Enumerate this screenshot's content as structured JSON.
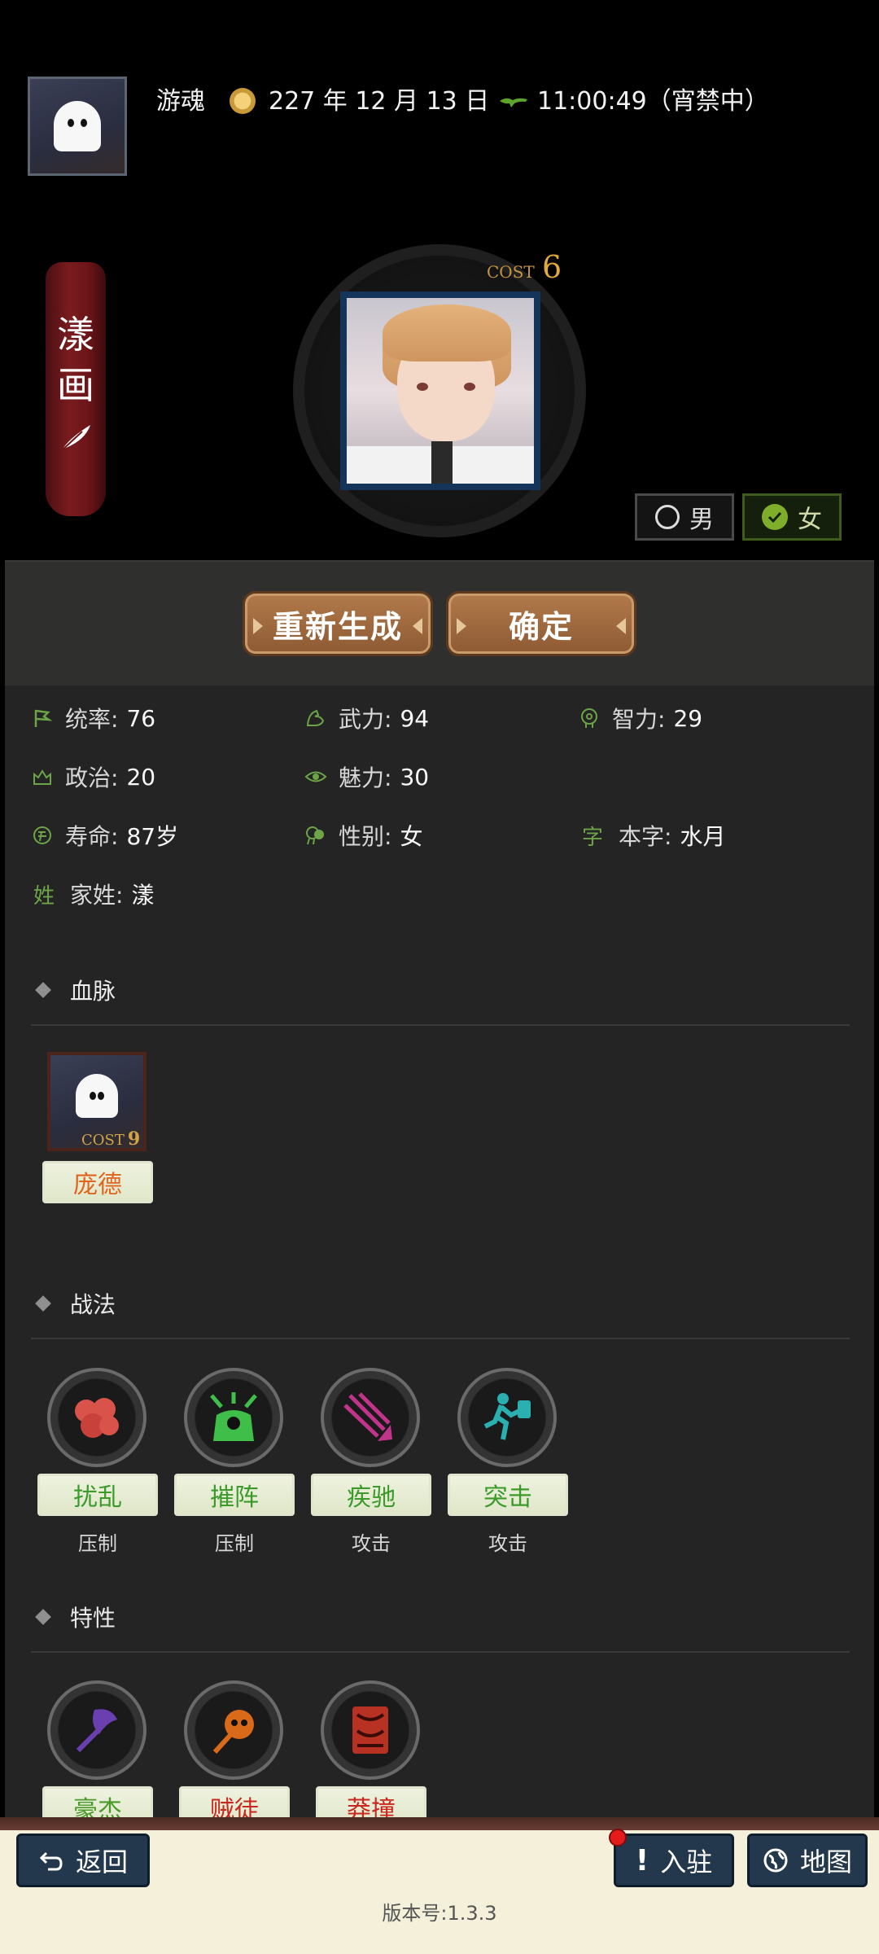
{
  "header": {
    "player_name": "游魂",
    "date": "227 年 12 月 13 日",
    "time": "11:00:49（宵禁中）"
  },
  "portrait": {
    "banner_text": [
      "漾",
      "画"
    ],
    "cost_label": "COST",
    "cost_value": "6"
  },
  "gender": {
    "male_label": "男",
    "female_label": "女",
    "selected": "女"
  },
  "actions": {
    "regenerate_label": "重新生成",
    "confirm_label": "确定"
  },
  "stats": {
    "command": {
      "label": "统率:",
      "value": "76"
    },
    "force": {
      "label": "武力:",
      "value": "94"
    },
    "intelligence": {
      "label": "智力:",
      "value": "29"
    },
    "politics": {
      "label": "政治:",
      "value": "20"
    },
    "charm": {
      "label": "魅力:",
      "value": "30"
    },
    "lifespan": {
      "label": "寿命:",
      "value": "87岁"
    },
    "sex": {
      "label": "性别:",
      "value": "女"
    },
    "courtesy": {
      "icon_char": "字",
      "label": "本字:",
      "value": "水月"
    },
    "surname": {
      "icon_char": "姓",
      "label": "家姓:",
      "value": "漾"
    }
  },
  "bloodline": {
    "title": "血脉",
    "card": {
      "cost_label": "COST",
      "cost_value": "9",
      "name": "庞德"
    }
  },
  "tactics": {
    "title": "战法",
    "items": [
      {
        "name": "扰乱",
        "type": "压制",
        "color": "#d9534a"
      },
      {
        "name": "摧阵",
        "type": "压制",
        "color": "#3fbf4a"
      },
      {
        "name": "疾驰",
        "type": "攻击",
        "color": "#c2338c"
      },
      {
        "name": "突击",
        "type": "攻击",
        "color": "#2ab0b0"
      }
    ]
  },
  "traits": {
    "title": "特性",
    "items": [
      {
        "name": "豪杰",
        "color": "#6a3fb0"
      },
      {
        "name": "贼徒",
        "color": "#d86a1a"
      },
      {
        "name": "莽撞",
        "color": "#b83224"
      }
    ]
  },
  "bottom": {
    "back_label": "返回",
    "station_label": "入驻",
    "map_label": "地图",
    "version": "版本号:1.3.3"
  }
}
